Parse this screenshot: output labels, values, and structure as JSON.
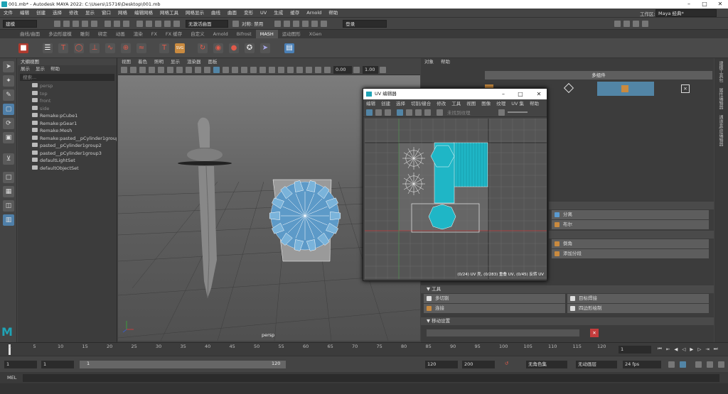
{
  "title_bar": {
    "title": "001.mb* - Autodesk MAYA 2022: C:\\Users\\15716\\Desktop\\001.mb"
  },
  "menubar": {
    "items": [
      "文件",
      "编辑",
      "创建",
      "选择",
      "修改",
      "显示",
      "窗口",
      "网格",
      "编辑网格",
      "网格工具",
      "网格显示",
      "曲线",
      "曲面",
      "变形",
      "UV",
      "生成",
      "缓存",
      "Arnold",
      "帮助"
    ],
    "workspace_label": "工作区:",
    "workspace_value": "Maya 经典*"
  },
  "statusline": {
    "mode": "建模",
    "no_live_surface": "无激活曲面",
    "symmetry": "对称: 禁用",
    "login": "登录"
  },
  "shelf": {
    "tabs": [
      "曲线/曲面",
      "多边形建模",
      "雕刻",
      "绑定",
      "动画",
      "渲染",
      "FX",
      "FX 缓存",
      "自定义",
      "Arnold",
      "Bifrost",
      "MASH",
      "运动图形",
      "XGen"
    ],
    "active_tab": "MASH"
  },
  "outliner": {
    "title": "大纲视图",
    "menu": [
      "展示",
      "显示",
      "帮助"
    ],
    "search_placeholder": "搜索...",
    "items": [
      {
        "name": "persp",
        "camera": true
      },
      {
        "name": "top",
        "camera": true
      },
      {
        "name": "front",
        "camera": true
      },
      {
        "name": "side",
        "camera": true
      },
      {
        "name": "Remake:pCube1",
        "camera": false
      },
      {
        "name": "Remake:pGear1",
        "camera": false
      },
      {
        "name": "Remake:Mesh",
        "camera": false
      },
      {
        "name": "Remake:pasted__pCylinder1group",
        "camera": false
      },
      {
        "name": "pasted__pCylinder1group2",
        "camera": false
      },
      {
        "name": "pasted__pCylinder1group3",
        "camera": false
      },
      {
        "name": "defaultLightSet",
        "camera": false
      },
      {
        "name": "defaultObjectSet",
        "camera": false
      }
    ]
  },
  "viewport": {
    "menu": [
      "视图",
      "着色",
      "照明",
      "显示",
      "渲染器",
      "面板"
    ],
    "field_a": "0.00",
    "field_b": "1.00",
    "camera_label": "persp"
  },
  "uv_editor": {
    "title": "UV 编辑器",
    "menu": [
      "编辑",
      "创建",
      "选择",
      "切割/缝合",
      "修改",
      "工具",
      "视图",
      "图像",
      "纹理",
      "UV 集",
      "帮助"
    ],
    "texture_placeholder": "未找到纹理",
    "status": "(0/24) UV 壳, (0/283) 重叠 UV, (0/45) 反转 UV"
  },
  "right_panel": {
    "menu": [
      "对象",
      "帮助"
    ],
    "header": "多组件",
    "section_tools": "工具",
    "section_move": "移动设置",
    "buttons_a": [
      "分离",
      "布尔"
    ],
    "buttons_b": [
      "倒角",
      "添加分段"
    ],
    "tools": [
      "多切割",
      "目标焊接",
      "连接",
      "四边形绘制"
    ],
    "side_tabs": [
      "建模工具包",
      "属性编辑器",
      "通道盒/层编辑器"
    ]
  },
  "timeline": {
    "ticks": [
      "1",
      "5",
      "10",
      "15",
      "20",
      "25",
      "30",
      "35",
      "40",
      "45",
      "50",
      "55",
      "60",
      "65",
      "70",
      "75",
      "80",
      "85",
      "90",
      "95",
      "100",
      "105",
      "110",
      "115",
      "120"
    ],
    "current_frame": "1"
  },
  "range": {
    "start": "1",
    "inner_start": "1",
    "slider_start": "1",
    "slider_end": "120",
    "end": "120",
    "outer_end": "200",
    "char_set": "无角色集",
    "anim_layer": "无动画层",
    "fps": "24 fps"
  },
  "command_line": {
    "label": "MEL"
  },
  "colors": {
    "accent": "#5285a6",
    "uv_shell": "#1fb6c6",
    "orange": "#c98a3f"
  }
}
